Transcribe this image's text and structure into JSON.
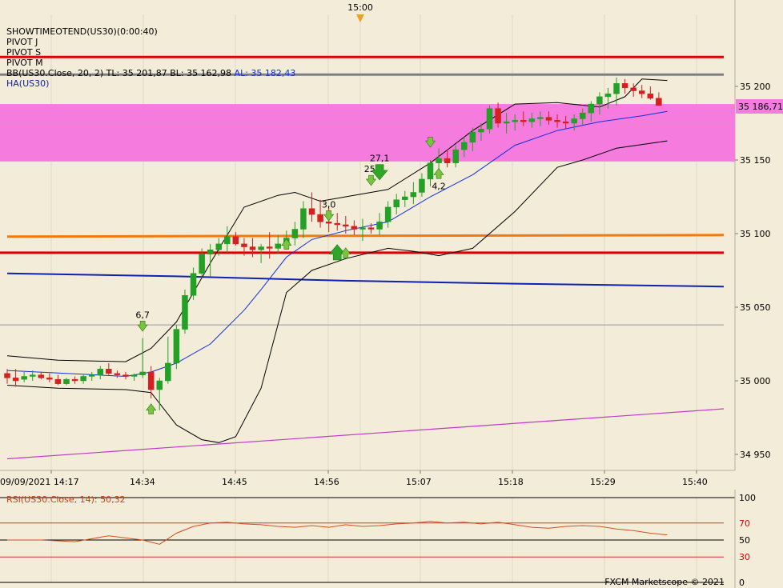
{
  "chart_data": [
    {
      "type": "candlestick",
      "marker_time": "15:00",
      "legend": {
        "line1": "SHOWTIMEOTEND(US30)(0:00:40)",
        "line2": "PIVOT J",
        "line3": "PIVOT S",
        "line4": "PIVOT M",
        "bb_prefix": "BB(US30.Close, 20, 2)",
        "bb_tl": "TL: 35 201,87",
        "bb_bl": "BL: 35 162,98",
        "bb_al": "AL: 35 182,43",
        "ha": "HA(US30)"
      },
      "price_tag": "35 186,71",
      "y_ticks": [
        "35 200",
        "35 150",
        "35 100",
        "35 050",
        "35 000",
        "34 950"
      ],
      "y_tick_values": [
        35200,
        35150,
        35100,
        35050,
        35000,
        34950
      ],
      "x_ticks": [
        "09/09/2021 14:17",
        "14:34",
        "14:45",
        "14:56",
        "15:07",
        "15:18",
        "15:29",
        "15:40"
      ],
      "ylim": [
        34945,
        35235
      ],
      "candles_ohlc": [
        [
          35005,
          35008,
          34998,
          35002
        ],
        [
          35002,
          35008,
          34996,
          35000
        ],
        [
          35001,
          35006,
          34999,
          35003
        ],
        [
          35003,
          35007,
          35000,
          35004
        ],
        [
          35004,
          35006,
          35001,
          35002
        ],
        [
          35002,
          35005,
          34999,
          35001
        ],
        [
          35001,
          35004,
          34997,
          34998
        ],
        [
          34998,
          35002,
          34997,
          35001
        ],
        [
          35001,
          35003,
          34998,
          35000
        ],
        [
          35000,
          35004,
          34998,
          35003
        ],
        [
          35003,
          35006,
          35000,
          35004
        ],
        [
          35004,
          35010,
          35001,
          35008
        ],
        [
          35008,
          35012,
          35004,
          35005
        ],
        [
          35005,
          35007,
          35002,
          35004
        ],
        [
          35004,
          35006,
          35001,
          35003
        ],
        [
          35003,
          35005,
          35000,
          35004
        ],
        [
          35004,
          35029,
          35002,
          35006
        ],
        [
          35006,
          35010,
          34988,
          34994
        ],
        [
          34994,
          35002,
          34980,
          35000
        ],
        [
          35000,
          35030,
          34998,
          35012
        ],
        [
          35012,
          35038,
          35008,
          35035
        ],
        [
          35035,
          35062,
          35032,
          35058
        ],
        [
          35058,
          35077,
          35055,
          35073
        ],
        [
          35073,
          35090,
          35070,
          35086
        ],
        [
          35086,
          35093,
          35071,
          35089
        ],
        [
          35089,
          35097,
          35085,
          35093
        ],
        [
          35093,
          35105,
          35087,
          35098
        ],
        [
          35098,
          35101,
          35092,
          35093
        ],
        [
          35093,
          35097,
          35085,
          35091
        ],
        [
          35091,
          35097,
          35084,
          35089
        ],
        [
          35089,
          35093,
          35080,
          35091
        ],
        [
          35091,
          35101,
          35083,
          35090
        ],
        [
          35090,
          35099,
          35086,
          35093
        ],
        [
          35093,
          35102,
          35089,
          35097
        ],
        [
          35097,
          35108,
          35092,
          35103
        ],
        [
          35103,
          35122,
          35097,
          35117
        ],
        [
          35117,
          35128,
          35108,
          35113
        ],
        [
          35113,
          35123,
          35104,
          35108
        ],
        [
          35108,
          35119,
          35101,
          35107
        ],
        [
          35107,
          35114,
          35102,
          35106
        ],
        [
          35106,
          35112,
          35100,
          35105
        ],
        [
          35105,
          35109,
          35099,
          35103
        ],
        [
          35103,
          35110,
          35095,
          35104
        ],
        [
          35104,
          35107,
          35100,
          35103
        ],
        [
          35103,
          35114,
          35099,
          35108
        ],
        [
          35108,
          35122,
          35104,
          35118
        ],
        [
          35118,
          35127,
          35113,
          35123
        ],
        [
          35123,
          35129,
          35118,
          35125
        ],
        [
          35125,
          35135,
          35120,
          35128
        ],
        [
          35128,
          35141,
          35125,
          35137
        ],
        [
          35137,
          35150,
          35132,
          35148
        ],
        [
          35148,
          35158,
          35143,
          35151
        ],
        [
          35151,
          35157,
          35145,
          35148
        ],
        [
          35148,
          35160,
          35145,
          35157
        ],
        [
          35157,
          35166,
          35152,
          35162
        ],
        [
          35162,
          35172,
          35156,
          35169
        ],
        [
          35169,
          35175,
          35163,
          35171
        ],
        [
          35171,
          35187,
          35168,
          35185
        ],
        [
          35185,
          35189,
          35172,
          35175
        ],
        [
          35175,
          35182,
          35168,
          35176
        ],
        [
          35176,
          35181,
          35170,
          35177
        ],
        [
          35177,
          35183,
          35173,
          35176
        ],
        [
          35176,
          35182,
          35172,
          35178
        ],
        [
          35178,
          35183,
          35173,
          35179
        ],
        [
          35179,
          35183,
          35174,
          35177
        ],
        [
          35177,
          35181,
          35172,
          35176
        ],
        [
          35176,
          35180,
          35171,
          35175
        ],
        [
          35175,
          35181,
          35170,
          35178
        ],
        [
          35178,
          35185,
          35174,
          35182
        ],
        [
          35182,
          35190,
          35176,
          35188
        ],
        [
          35188,
          35196,
          35181,
          35193
        ],
        [
          35193,
          35199,
          35185,
          35195
        ],
        [
          35195,
          35206,
          35187,
          35202
        ],
        [
          35202,
          35205,
          35195,
          35199
        ],
        [
          35199,
          35202,
          35193,
          35197
        ],
        [
          35197,
          35201,
          35192,
          35195
        ],
        [
          35195,
          35200,
          35191,
          35192
        ],
        [
          35192,
          35196,
          35187,
          35187
        ]
      ],
      "bb_upper": [
        [
          0,
          35017
        ],
        [
          6,
          35014
        ],
        [
          14,
          35013
        ],
        [
          17,
          35022
        ],
        [
          20,
          35040
        ],
        [
          24,
          35080
        ],
        [
          28,
          35118
        ],
        [
          32,
          35126
        ],
        [
          34,
          35128
        ],
        [
          37,
          35122
        ],
        [
          40,
          35125
        ],
        [
          45,
          35130
        ],
        [
          50,
          35148
        ],
        [
          55,
          35170
        ],
        [
          60,
          35188
        ],
        [
          65,
          35189
        ],
        [
          70,
          35186
        ],
        [
          73,
          35193
        ],
        [
          75,
          35205
        ],
        [
          78,
          35204
        ]
      ],
      "bb_lower": [
        [
          0,
          34997
        ],
        [
          6,
          34995
        ],
        [
          14,
          34994
        ],
        [
          17,
          34992
        ],
        [
          20,
          34970
        ],
        [
          23,
          34960
        ],
        [
          25,
          34958
        ],
        [
          27,
          34962
        ],
        [
          30,
          34995
        ],
        [
          33,
          35060
        ],
        [
          36,
          35075
        ],
        [
          40,
          35083
        ],
        [
          45,
          35090
        ],
        [
          48,
          35088
        ],
        [
          51,
          35085
        ],
        [
          55,
          35090
        ],
        [
          60,
          35115
        ],
        [
          65,
          35145
        ],
        [
          68,
          35150
        ],
        [
          72,
          35158
        ],
        [
          78,
          35163
        ]
      ],
      "bb_mid": [
        [
          0,
          35007
        ],
        [
          14,
          35003
        ],
        [
          17,
          35006
        ],
        [
          20,
          35012
        ],
        [
          24,
          35025
        ],
        [
          28,
          35048
        ],
        [
          30,
          35062
        ],
        [
          33,
          35084
        ],
        [
          36,
          35096
        ],
        [
          40,
          35102
        ],
        [
          45,
          35108
        ],
        [
          50,
          35125
        ],
        [
          55,
          35140
        ],
        [
          60,
          35160
        ],
        [
          65,
          35170
        ],
        [
          70,
          35176
        ],
        [
          75,
          35180
        ],
        [
          78,
          35183
        ]
      ],
      "pivot_lines": [
        {
          "name": "pivot-red-top",
          "value": 35220,
          "color": "#dd0000"
        },
        {
          "name": "pivot-gray",
          "value": 35208,
          "color": "#808080"
        },
        {
          "name": "pivot-red-mid",
          "value": 35087,
          "color": "#dd0000"
        },
        {
          "name": "pivot-gray-thin",
          "value": 35038,
          "color": "#999999"
        }
      ],
      "zone": {
        "top": 35188,
        "bottom": 35149,
        "color": "#f57bdf",
        "midline": 35172
      },
      "orange_line": [
        [
          0,
          35098
        ],
        [
          78,
          35099
        ]
      ],
      "blue_line": [
        [
          0,
          35073
        ],
        [
          20,
          35071
        ],
        [
          40,
          35068
        ],
        [
          60,
          35066
        ],
        [
          78,
          35064
        ]
      ],
      "violet_line": [
        [
          0,
          34947
        ],
        [
          78,
          34981
        ]
      ],
      "signals": [
        {
          "index": 17,
          "price": 34980,
          "dir": "up",
          "label": ""
        },
        {
          "index": 16,
          "price": 35038,
          "dir": "down",
          "label": "6,7"
        },
        {
          "index": 33,
          "price": 35092,
          "dir": "up",
          "label": ""
        },
        {
          "index": 39,
          "price": 35086,
          "dir": "up",
          "label": "",
          "big": true
        },
        {
          "index": 40,
          "price": 35086,
          "dir": "up",
          "label": ""
        },
        {
          "index": 38,
          "price": 35113,
          "dir": "down",
          "label": "3,0"
        },
        {
          "index": 43,
          "price": 35137,
          "dir": "down",
          "label": "25,"
        },
        {
          "index": 44,
          "price": 35143,
          "dir": "down",
          "label": "27,1",
          "big": true
        },
        {
          "index": 50,
          "price": 35163,
          "dir": "down",
          "label": ""
        },
        {
          "index": 51,
          "price": 35140,
          "dir": "up",
          "label": "4,2"
        }
      ]
    },
    {
      "type": "line",
      "title": "RSI(US30.Close, 14): 50,32",
      "y_ticks": [
        "100",
        "70",
        "50",
        "30",
        "0"
      ],
      "y_tick_values": [
        100,
        70,
        50,
        30,
        0
      ],
      "ylim": [
        0,
        100
      ],
      "values": [
        [
          0,
          50
        ],
        [
          4,
          50
        ],
        [
          8,
          48
        ],
        [
          12,
          55
        ],
        [
          16,
          50
        ],
        [
          18,
          45
        ],
        [
          20,
          58
        ],
        [
          22,
          66
        ],
        [
          24,
          70
        ],
        [
          26,
          71
        ],
        [
          28,
          69
        ],
        [
          30,
          68
        ],
        [
          32,
          66
        ],
        [
          34,
          65
        ],
        [
          36,
          67
        ],
        [
          38,
          65
        ],
        [
          40,
          68
        ],
        [
          42,
          66
        ],
        [
          44,
          67
        ],
        [
          46,
          69
        ],
        [
          48,
          70
        ],
        [
          50,
          72
        ],
        [
          52,
          70
        ],
        [
          54,
          71
        ],
        [
          56,
          69
        ],
        [
          58,
          71
        ],
        [
          60,
          68
        ],
        [
          62,
          65
        ],
        [
          64,
          64
        ],
        [
          66,
          66
        ],
        [
          68,
          67
        ],
        [
          70,
          66
        ],
        [
          72,
          63
        ],
        [
          74,
          61
        ],
        [
          76,
          58
        ],
        [
          78,
          56
        ]
      ]
    }
  ],
  "footer": "FXCM Marketscope © 2021",
  "colors": {
    "bull": "#23a026",
    "bear": "#d42020",
    "background": "#f3ecd9"
  }
}
